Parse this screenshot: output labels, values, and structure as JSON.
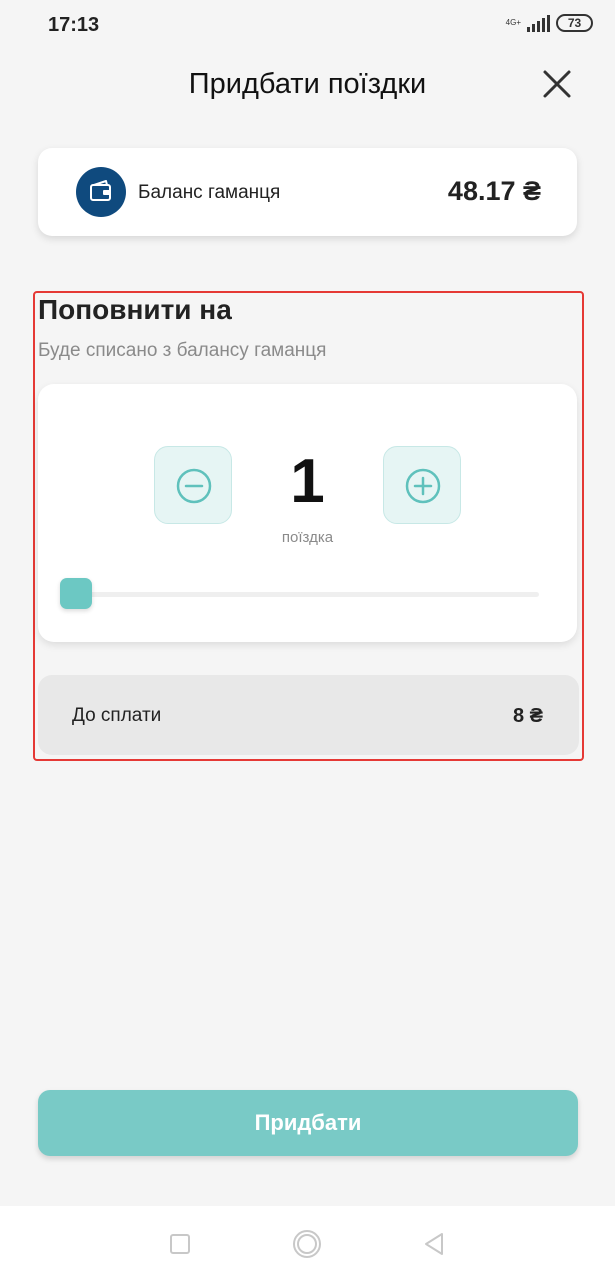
{
  "status_bar": {
    "time": "17:13",
    "network": "4G+",
    "battery": "73"
  },
  "header": {
    "title": "Придбати поїздки"
  },
  "wallet": {
    "label": "Баланс гаманця",
    "amount": "48.17 ₴"
  },
  "topup": {
    "title": "Поповнити на",
    "subtitle": "Буде списано з балансу гаманця",
    "count": "1",
    "unit": "поїздка",
    "slider_fraction": 0.0
  },
  "total": {
    "label": "До сплати",
    "amount": "8 ₴"
  },
  "buy_button": {
    "label": "Придбати"
  },
  "colors": {
    "accent": "#6cc8c3",
    "button": "#79cac6",
    "wallet_icon_bg": "#0f4a7e",
    "highlight_border": "#e53935"
  }
}
